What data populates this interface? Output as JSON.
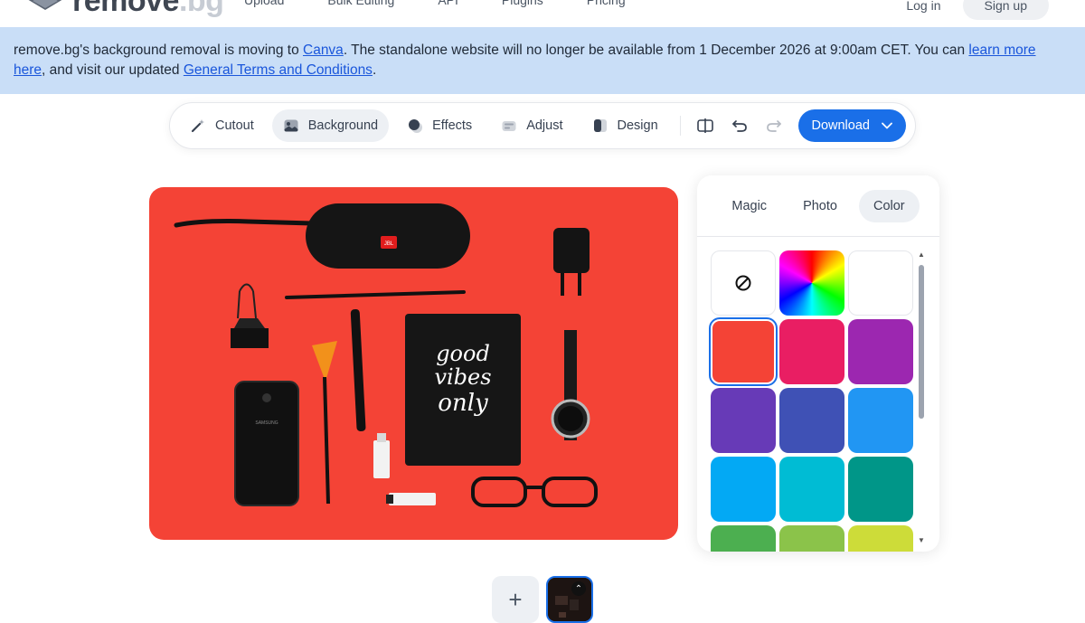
{
  "nav": {
    "logo_text": "remove",
    "logo_suffix": ".bg",
    "links": [
      "Upload",
      "Bulk Editing",
      "API",
      "Plugins",
      "Pricing"
    ],
    "login": "Log in",
    "signup": "Sign up"
  },
  "banner": {
    "text_1": "remove.bg's background removal is moving to ",
    "link_canva": "Canva",
    "text_2": ". The standalone website will no longer be available from 1 December 2026 at 9:00am CET. You can ",
    "link_learn": "learn more here",
    "text_3": ", and visit our updated ",
    "link_terms": "General Terms and Conditions",
    "text_4": "."
  },
  "toolbar": {
    "tools": [
      {
        "label": "Cutout",
        "icon": "magic-wand-icon"
      },
      {
        "label": "Background",
        "icon": "image-icon",
        "active": true
      },
      {
        "label": "Effects",
        "icon": "effects-icon"
      },
      {
        "label": "Adjust",
        "icon": "adjust-icon"
      },
      {
        "label": "Design",
        "icon": "design-icon"
      }
    ],
    "download_label": "Download"
  },
  "canvas": {
    "background_color": "#f44336",
    "notebook_text": [
      "good",
      "vibes",
      "only"
    ],
    "speaker_brand": "JBL",
    "phone_brand": "SAMSUNG"
  },
  "panel": {
    "tabs": [
      {
        "label": "Magic",
        "active": false
      },
      {
        "label": "Photo",
        "active": false
      },
      {
        "label": "Color",
        "active": true
      }
    ],
    "swatches": [
      {
        "type": "none",
        "icon": "no-color-icon"
      },
      {
        "type": "rainbow"
      },
      {
        "type": "color",
        "color": "#ffffff"
      },
      {
        "type": "color",
        "color": "#f44336",
        "selected": true
      },
      {
        "type": "color",
        "color": "#e91e63"
      },
      {
        "type": "color",
        "color": "#9c27b0"
      },
      {
        "type": "color",
        "color": "#673ab7"
      },
      {
        "type": "color",
        "color": "#3f51b5"
      },
      {
        "type": "color",
        "color": "#2196f3"
      },
      {
        "type": "color",
        "color": "#03a9f4"
      },
      {
        "type": "color",
        "color": "#00bcd4"
      },
      {
        "type": "color",
        "color": "#009688"
      },
      {
        "type": "color",
        "color": "#4caf50"
      },
      {
        "type": "color",
        "color": "#8bc34a"
      },
      {
        "type": "color",
        "color": "#cddc39"
      }
    ]
  },
  "bottom": {
    "add_label": "+"
  }
}
